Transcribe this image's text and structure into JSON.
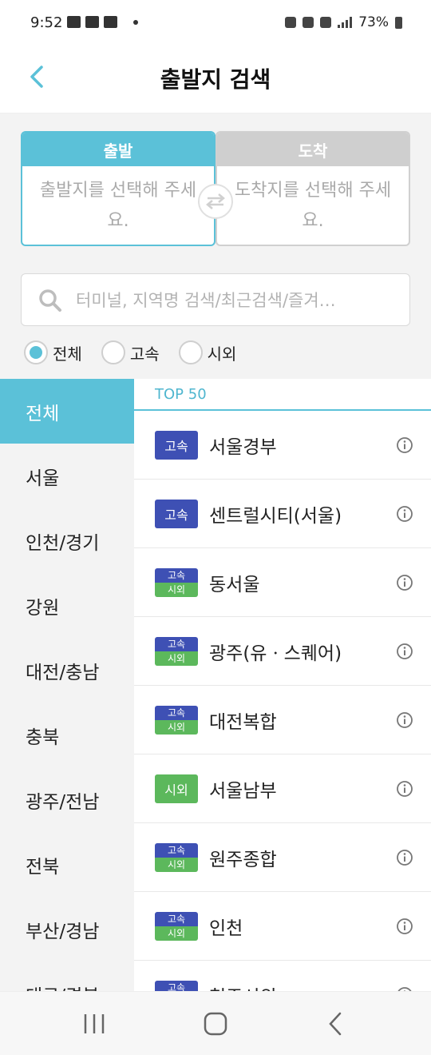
{
  "status_bar": {
    "time": "9:52",
    "battery": "73%"
  },
  "header": {
    "title": "출발지 검색"
  },
  "selector": {
    "departure": {
      "label": "출발",
      "placeholder": "출발지를 선택해 주세요."
    },
    "arrival": {
      "label": "도착",
      "placeholder": "도착지를 선택해 주세요."
    }
  },
  "search": {
    "placeholder": "터미널, 지역명 검색/최근검색/즐겨…"
  },
  "filters": [
    {
      "label": "전체",
      "selected": true
    },
    {
      "label": "고속",
      "selected": false
    },
    {
      "label": "시외",
      "selected": false
    }
  ],
  "regions": [
    "전체",
    "서울",
    "인천/경기",
    "강원",
    "대전/충남",
    "충북",
    "광주/전남",
    "전북",
    "부산/경남",
    "대구/경북"
  ],
  "list": {
    "header": "TOP 50",
    "badges": {
      "express": "고속",
      "intercity": "시외"
    },
    "rows": [
      {
        "name": "서울경부",
        "type": "express"
      },
      {
        "name": "센트럴시티(서울)",
        "type": "express"
      },
      {
        "name": "동서울",
        "type": "both"
      },
      {
        "name": "광주(유ㆍ스퀘어)",
        "type": "both"
      },
      {
        "name": "대전복합",
        "type": "both"
      },
      {
        "name": "서울남부",
        "type": "intercity"
      },
      {
        "name": "원주종합",
        "type": "both"
      },
      {
        "name": "인천",
        "type": "both"
      },
      {
        "name": "청주시외",
        "type": "both"
      }
    ]
  },
  "colors": {
    "accent": "#5bc1d8",
    "express": "#3e50b4",
    "intercity": "#5cb85c"
  },
  "icons": [
    "back-arrow-icon",
    "swap-icon",
    "search-icon",
    "info-icon",
    "recent-apps-icon",
    "home-icon",
    "nav-back-icon"
  ]
}
